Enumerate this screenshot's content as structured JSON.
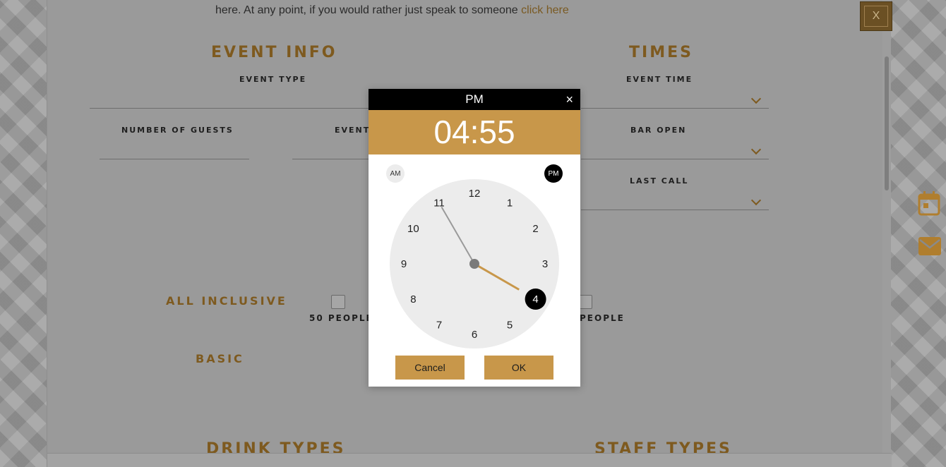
{
  "intro": {
    "text": "here. At any point, if you would rather just speak to someone",
    "link": "click here"
  },
  "close_button": {
    "label": "X"
  },
  "sections": {
    "event_info": "EVENT INFO",
    "times": "TIMES",
    "drink_types": "DRINK TYPES",
    "staff_types": "STAFF TYPES"
  },
  "fields": {
    "event_type": "EVENT TYPE",
    "number_of_guests": "NUMBER OF GUESTS",
    "event_partial": "EVENT",
    "event_time": "EVENT TIME",
    "bar_open": "BAR OPEN",
    "last_call": "LAST CALL"
  },
  "packages": {
    "all_inclusive": "ALL INCLUSIVE",
    "basic": "BASIC",
    "people_50": "50 PEOPLE",
    "people_partial": "PEOPLE"
  },
  "time_picker": {
    "header": "PM",
    "close": "×",
    "time": "04:55",
    "am": "AM",
    "pm": "PM",
    "hours": [
      "12",
      "1",
      "2",
      "3",
      "4",
      "5",
      "6",
      "7",
      "8",
      "9",
      "10",
      "11"
    ],
    "selected_hour": 4,
    "minute": 55,
    "cancel": "Cancel",
    "ok": "OK"
  },
  "colors": {
    "accent_gold": "#c8974a",
    "dim_gold": "#7e5a1f",
    "header_black": "#000000"
  },
  "icons": [
    "calendar-icon",
    "mail-icon",
    "chevron-down-icon"
  ]
}
